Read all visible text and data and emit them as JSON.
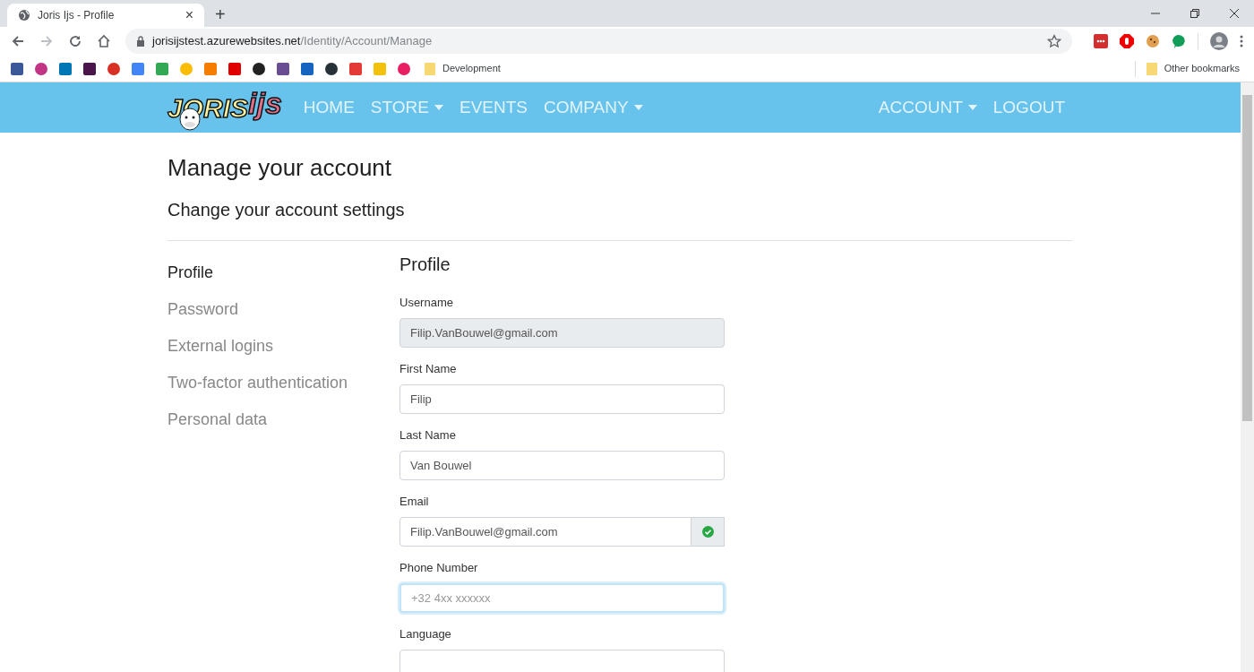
{
  "browser": {
    "tab": {
      "title": "Joris Ijs - Profile",
      "close": "×"
    },
    "new_tab": "+",
    "url_host": "jorisijstest.azurewebsites.net",
    "url_path": "/Identity/Account/Manage",
    "bookmark_folder": "Development",
    "other_bookmarks": "Other bookmarks"
  },
  "navbar": {
    "logo": {
      "part_1": "JORIS",
      "part_2": "ijs"
    },
    "left_links": [
      {
        "label": "HOME",
        "dropdown": false
      },
      {
        "label": "STORE",
        "dropdown": true
      },
      {
        "label": "EVENTS",
        "dropdown": false
      },
      {
        "label": "COMPANY",
        "dropdown": true
      }
    ],
    "right_links": [
      {
        "label": "ACCOUNT",
        "dropdown": true
      },
      {
        "label": "LOGOUT",
        "dropdown": false
      }
    ]
  },
  "page": {
    "title": "Manage your account",
    "subtitle": "Change your account settings"
  },
  "sidebar": {
    "items": [
      {
        "label": "Profile",
        "selected": true
      },
      {
        "label": "Password",
        "selected": false
      },
      {
        "label": "External logins",
        "selected": false
      },
      {
        "label": "Two-factor authentication",
        "selected": false
      },
      {
        "label": "Personal data",
        "selected": false
      }
    ]
  },
  "form": {
    "title": "Profile",
    "fields": [
      {
        "label": "Username",
        "value": "Filip.VanBouwel@gmail.com",
        "disabled": true,
        "focused": false,
        "verified": false
      },
      {
        "label": "First Name",
        "value": "Filip",
        "disabled": false,
        "focused": false,
        "verified": false
      },
      {
        "label": "Last Name",
        "value": "Van Bouwel",
        "disabled": false,
        "focused": false,
        "verified": false
      },
      {
        "label": "Email",
        "value": "Filip.VanBouwel@gmail.com",
        "disabled": false,
        "focused": false,
        "verified": true
      },
      {
        "label": "Phone Number",
        "placeholder": "+32 4xx xxxxxx",
        "disabled": false,
        "focused": true,
        "verified": false
      },
      {
        "label": "Language",
        "disabled": false,
        "focused": false,
        "verified": false
      }
    ]
  }
}
